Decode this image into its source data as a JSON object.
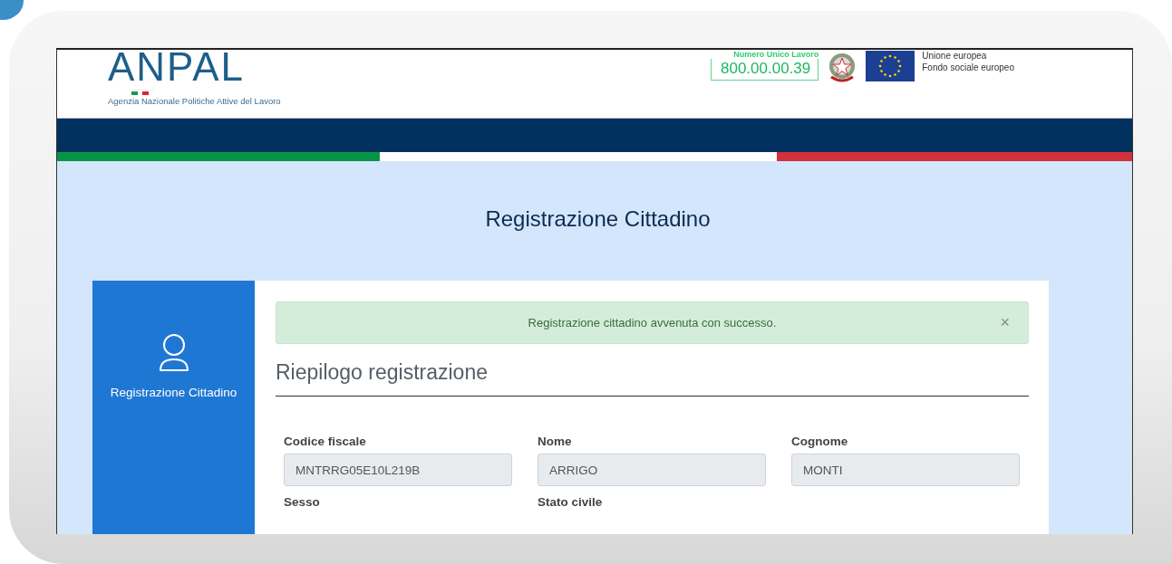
{
  "header": {
    "logo": "ANPAL",
    "agency": "Agenzia Nazionale Politiche Attive del Lavoro",
    "phone_label": "Numero Unico Lavoro",
    "phone": "800.00.00.39",
    "eu_lines": [
      "Unione europea",
      "Fondo sociale europeo"
    ]
  },
  "page_title": "Registrazione Cittadino",
  "sidebar": {
    "items": [
      {
        "label": "Registrazione Cittadino",
        "selected": true
      }
    ]
  },
  "alert": {
    "message": "Registrazione cittadino avvenuta con successo.",
    "close": "×"
  },
  "section_title": "Riepilogo registrazione",
  "fields": [
    {
      "label": "Codice fiscale",
      "value": "MNTRRG05E10L219B"
    },
    {
      "label": "Nome",
      "value": "ARRIGO"
    },
    {
      "label": "Cognome",
      "value": "MONTI"
    },
    {
      "label": "Sesso"
    },
    {
      "label": "Stato civile"
    }
  ]
}
